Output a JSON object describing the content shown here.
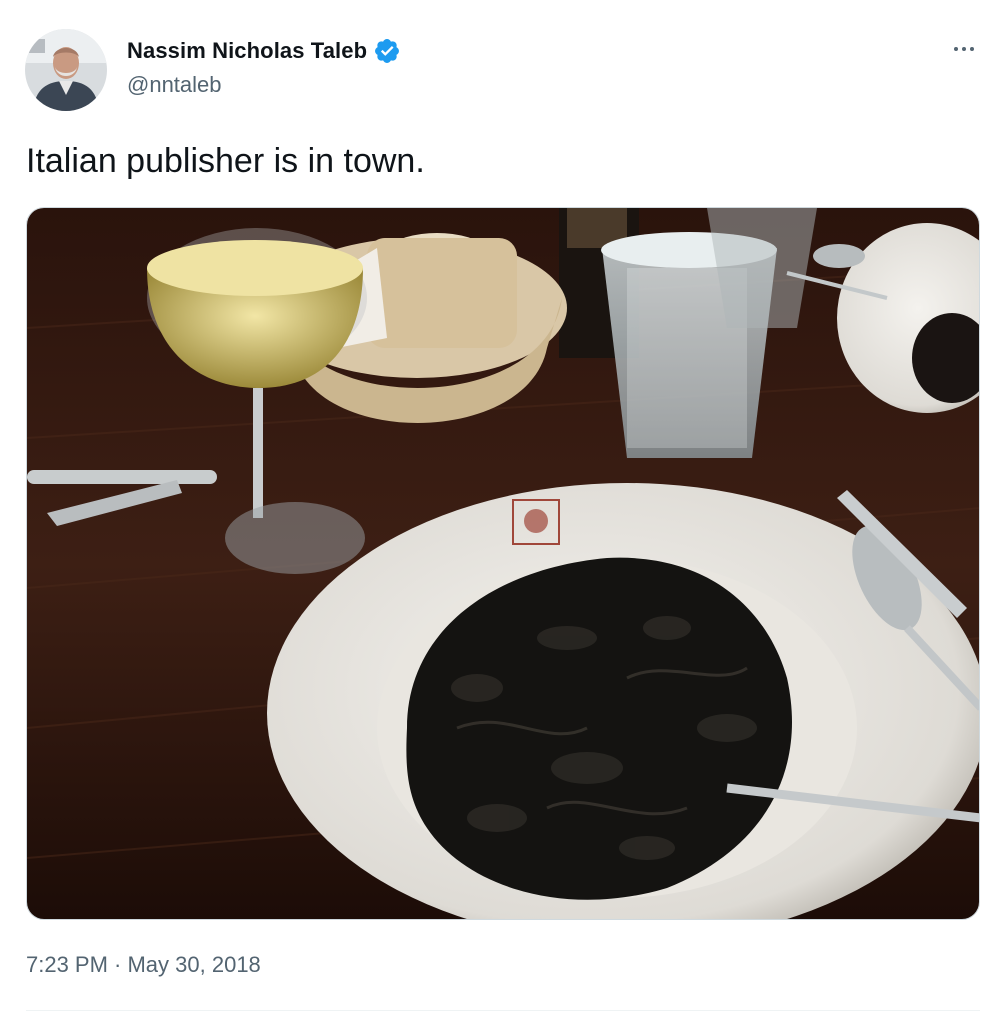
{
  "author": {
    "display_name": "Nassim Nicholas Taleb",
    "handle": "@nntaleb",
    "verified": true,
    "avatar_icon": "profile-photo"
  },
  "tweet": {
    "text": "Italian publisher is in town.",
    "timestamp": "7:23 PM · May 30, 2018"
  },
  "menu": {
    "icon": "more-horizontal-icon"
  },
  "colors": {
    "verified_badge": "#1d9bf0",
    "secondary_text": "#536471",
    "primary_text": "#0f1419"
  }
}
